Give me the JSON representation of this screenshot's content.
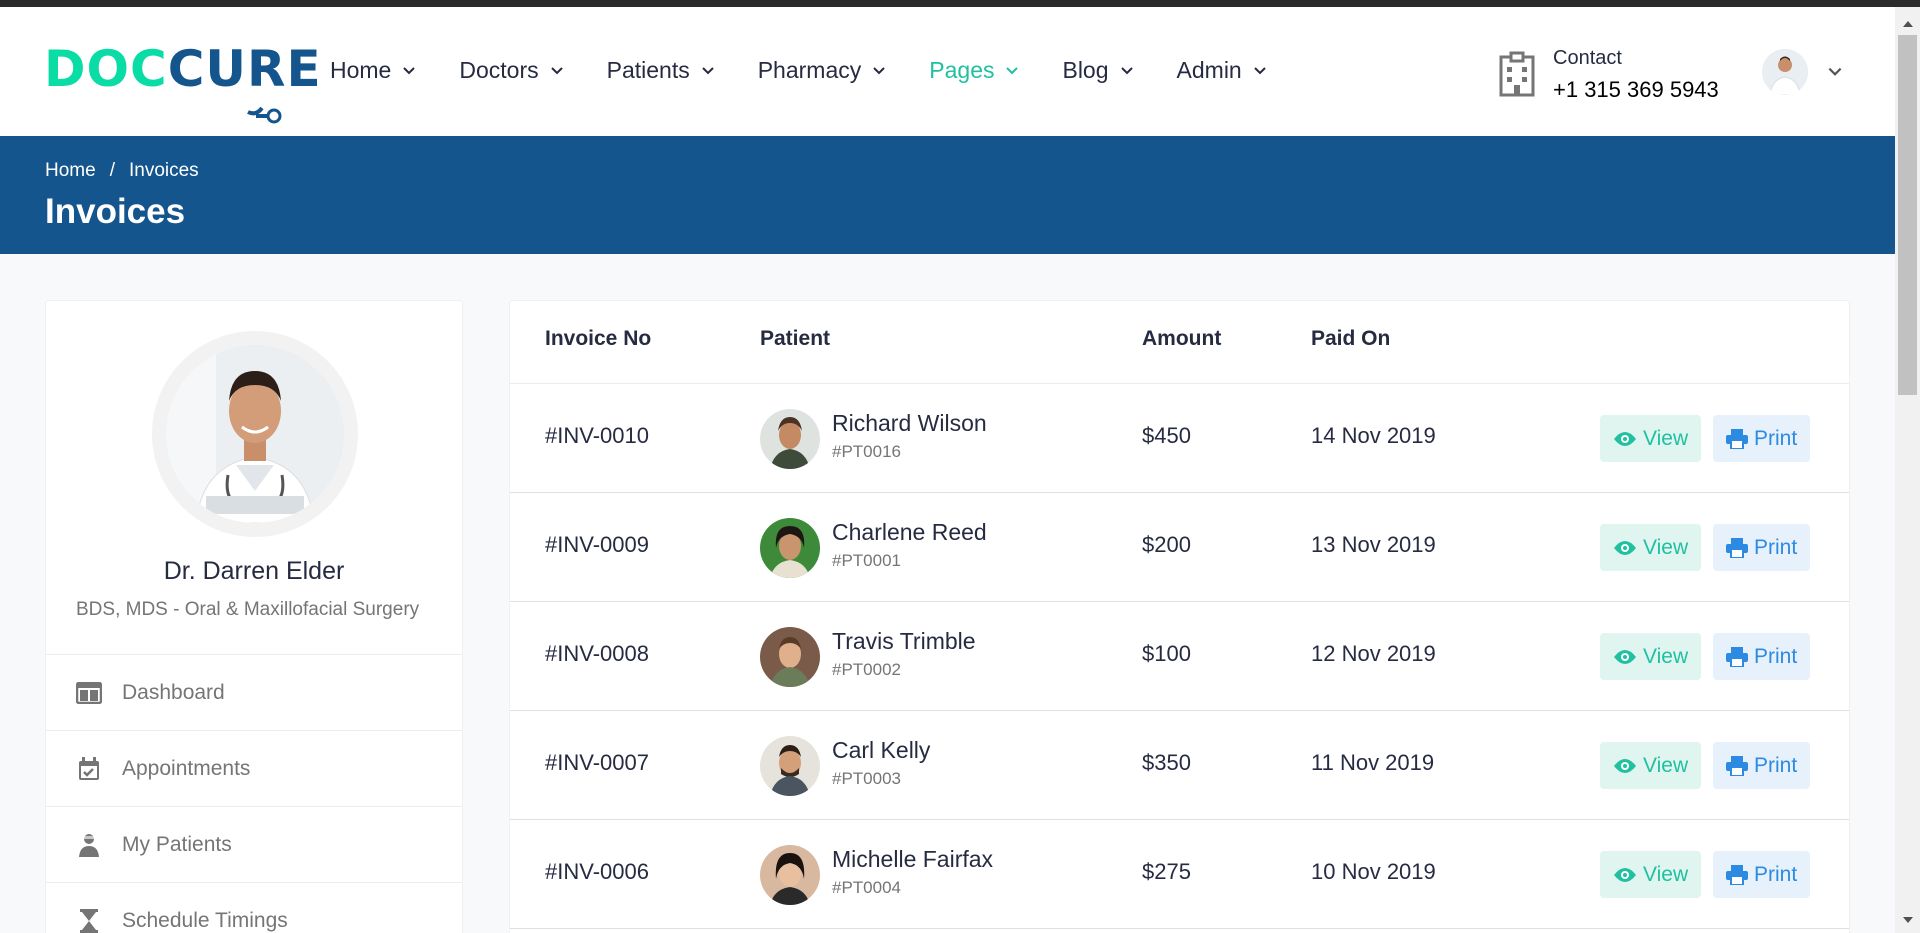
{
  "header": {
    "logo": "DOCCURE",
    "nav": [
      {
        "label": "Home",
        "active": false
      },
      {
        "label": "Doctors",
        "active": false
      },
      {
        "label": "Patients",
        "active": false
      },
      {
        "label": "Pharmacy",
        "active": false
      },
      {
        "label": "Pages",
        "active": true
      },
      {
        "label": "Blog",
        "active": false
      },
      {
        "label": "Admin",
        "active": false
      }
    ],
    "contact_label": "Contact",
    "contact_phone": "+1 315 369 5943"
  },
  "breadcrumb": {
    "home": "Home",
    "separator": "/",
    "current": "Invoices"
  },
  "page_title": "Invoices",
  "sidebar": {
    "doctor_name": "Dr. Darren Elder",
    "doctor_specialty": "BDS, MDS - Oral & Maxillofacial Surgery",
    "items": [
      {
        "label": "Dashboard",
        "icon": "columns-icon"
      },
      {
        "label": "Appointments",
        "icon": "calendar-check-icon"
      },
      {
        "label": "My Patients",
        "icon": "user-injured-icon"
      },
      {
        "label": "Schedule Timings",
        "icon": "hourglass-icon"
      }
    ]
  },
  "table": {
    "columns": [
      "Invoice No",
      "Patient",
      "Amount",
      "Paid On"
    ],
    "view_label": "View",
    "print_label": "Print",
    "rows": [
      {
        "invoice": "#INV-0010",
        "patient": "Richard Wilson",
        "patient_id": "#PT0016",
        "amount": "$450",
        "paid_on": "14 Nov 2019"
      },
      {
        "invoice": "#INV-0009",
        "patient": "Charlene Reed",
        "patient_id": "#PT0001",
        "amount": "$200",
        "paid_on": "13 Nov 2019"
      },
      {
        "invoice": "#INV-0008",
        "patient": "Travis Trimble",
        "patient_id": "#PT0002",
        "amount": "$100",
        "paid_on": "12 Nov 2019"
      },
      {
        "invoice": "#INV-0007",
        "patient": "Carl Kelly",
        "patient_id": "#PT0003",
        "amount": "$350",
        "paid_on": "11 Nov 2019"
      },
      {
        "invoice": "#INV-0006",
        "patient": "Michelle Fairfax",
        "patient_id": "#PT0004",
        "amount": "$275",
        "paid_on": "10 Nov 2019"
      }
    ]
  },
  "colors": {
    "brand_blue": "#15558d",
    "accent_green": "#20c0a0",
    "print_blue": "#2d8ae3"
  }
}
